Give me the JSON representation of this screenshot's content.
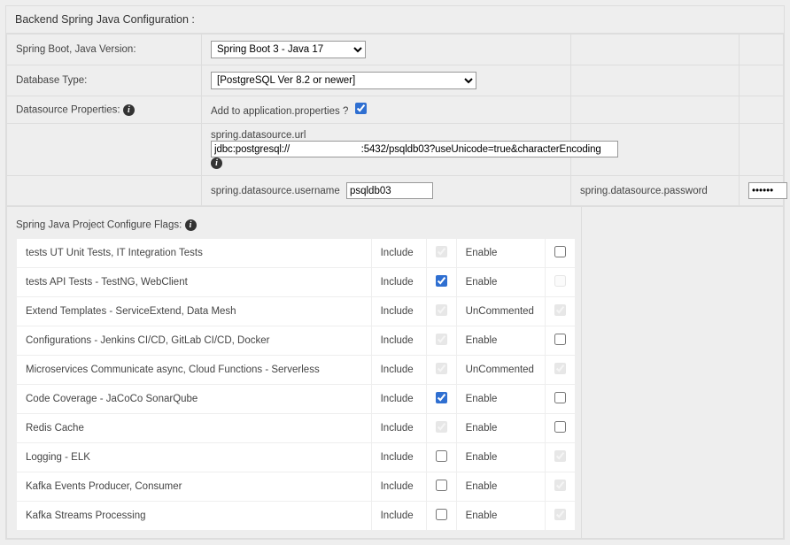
{
  "section_title": "Backend Spring Java Configuration :",
  "row_version": {
    "label": "Spring Boot, Java Version:",
    "selected": "Spring Boot 3 - Java 17"
  },
  "row_dbtype": {
    "label": "Database Type:",
    "selected": "[PostgreSQL Ver 8.2 or newer]"
  },
  "row_dsprops": {
    "label": "Datasource Properties:",
    "prompt": "Add to application.properties ?",
    "checked": true
  },
  "row_url": {
    "label": "spring.datasource.url",
    "value": "jdbc:postgresql://                          :5432/psqldb03?useUnicode=true&characterEncoding"
  },
  "row_user": {
    "label": "spring.datasource.username",
    "value": "psqldb03",
    "pw_label": "spring.datasource.password",
    "pw_value": "••••••"
  },
  "flags_header": "Spring Java Project Configure Flags:",
  "col_include": "Include",
  "flags": [
    {
      "name": "tests UT Unit Tests, IT Integration Tests",
      "inc_checked": true,
      "inc_disabled": true,
      "en_label": "Enable",
      "en_checked": false,
      "en_disabled": false
    },
    {
      "name": "tests API Tests - TestNG, WebClient",
      "inc_checked": true,
      "inc_disabled": false,
      "en_label": "Enable",
      "en_checked": false,
      "en_disabled": true
    },
    {
      "name": "Extend Templates - ServiceExtend, Data Mesh",
      "inc_checked": true,
      "inc_disabled": true,
      "en_label": "UnCommented",
      "en_checked": true,
      "en_disabled": true
    },
    {
      "name": "Configurations - Jenkins CI/CD, GitLab CI/CD, Docker",
      "inc_checked": true,
      "inc_disabled": true,
      "en_label": "Enable",
      "en_checked": false,
      "en_disabled": false
    },
    {
      "name": "Microservices Communicate async, Cloud Functions - Serverless",
      "inc_checked": true,
      "inc_disabled": true,
      "en_label": "UnCommented",
      "en_checked": true,
      "en_disabled": true
    },
    {
      "name": "Code Coverage - JaCoCo SonarQube",
      "inc_checked": true,
      "inc_disabled": false,
      "en_label": "Enable",
      "en_checked": false,
      "en_disabled": false
    },
    {
      "name": "Redis Cache",
      "inc_checked": true,
      "inc_disabled": true,
      "en_label": "Enable",
      "en_checked": false,
      "en_disabled": false
    },
    {
      "name": "Logging - ELK",
      "inc_checked": false,
      "inc_disabled": false,
      "en_label": "Enable",
      "en_checked": true,
      "en_disabled": true
    },
    {
      "name": "Kafka Events Producer, Consumer",
      "inc_checked": false,
      "inc_disabled": false,
      "en_label": "Enable",
      "en_checked": true,
      "en_disabled": true
    },
    {
      "name": "Kafka Streams Processing",
      "inc_checked": false,
      "inc_disabled": false,
      "en_label": "Enable",
      "en_checked": true,
      "en_disabled": true
    }
  ]
}
